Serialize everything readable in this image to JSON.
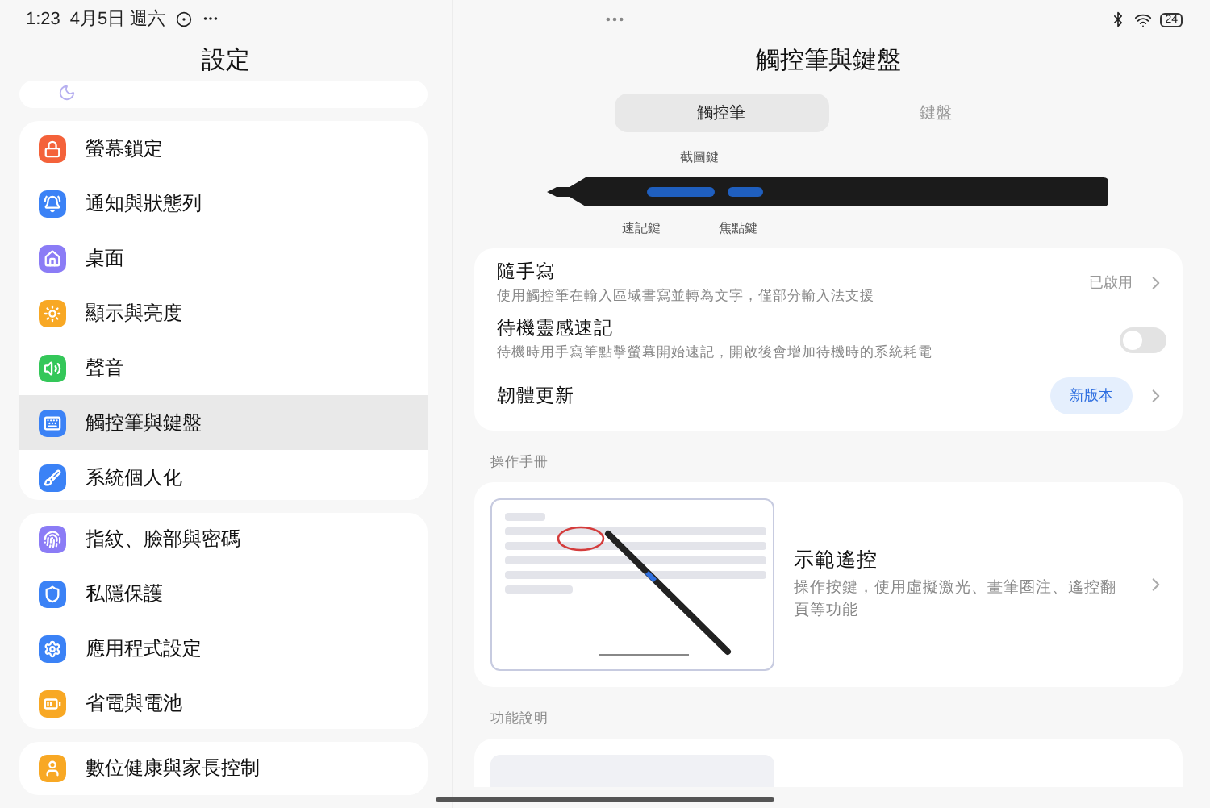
{
  "status_bar": {
    "time": "1:23",
    "date": "4月5日 週六",
    "battery": "24"
  },
  "sidebar": {
    "title": "設定",
    "groups": [
      {
        "items": [
          {
            "label": "螢幕鎖定",
            "color": "#f4623a",
            "selected": false
          },
          {
            "label": "通知與狀態列",
            "color": "#3b82f6",
            "selected": false
          },
          {
            "label": "桌面",
            "color": "#8b7cf6",
            "selected": false
          },
          {
            "label": "顯示與亮度",
            "color": "#f8a824",
            "selected": false
          },
          {
            "label": "聲音",
            "color": "#34c759",
            "selected": false
          },
          {
            "label": "觸控筆與鍵盤",
            "color": "#3b82f6",
            "selected": true
          },
          {
            "label": "系統個人化",
            "color": "#3b82f6",
            "selected": false
          }
        ]
      },
      {
        "items": [
          {
            "label": "指紋、臉部與密碼",
            "color": "#8b7cf6",
            "selected": false
          },
          {
            "label": "私隱保護",
            "color": "#3b82f6",
            "selected": false
          },
          {
            "label": "應用程式設定",
            "color": "#3b82f6",
            "selected": false
          },
          {
            "label": "省電與電池",
            "color": "#f8a824",
            "selected": false
          }
        ]
      },
      {
        "items": [
          {
            "label": "數位健康與家長控制",
            "color": "#f8a824",
            "selected": false
          }
        ]
      }
    ]
  },
  "detail": {
    "title": "觸控筆與鍵盤",
    "tabs": [
      {
        "label": "觸控筆",
        "selected": true
      },
      {
        "label": "鍵盤",
        "selected": false
      }
    ],
    "pen_labels": {
      "top": "截圖鍵",
      "bottom_left": "速記鍵",
      "bottom_right": "焦點鍵"
    },
    "rows": [
      {
        "kind": "link",
        "title": "隨手寫",
        "subtitle": "使用觸控筆在輸入區域書寫並轉為文字，僅部分輸入法支援",
        "value": "已啟用"
      },
      {
        "kind": "toggle",
        "title": "待機靈感速記",
        "subtitle": "待機時用手寫筆點擊螢幕開始速記，開啟後會增加待機時的系統耗電",
        "on": false
      },
      {
        "kind": "badge",
        "title": "韌體更新",
        "badge": "新版本"
      }
    ],
    "sections": [
      {
        "label": "操作手冊",
        "card": {
          "title": "示範遙控",
          "description": "操作按鍵，使用虛擬激光、畫筆圈注、遙控翻頁等功能"
        }
      },
      {
        "label": "功能說明"
      }
    ]
  }
}
